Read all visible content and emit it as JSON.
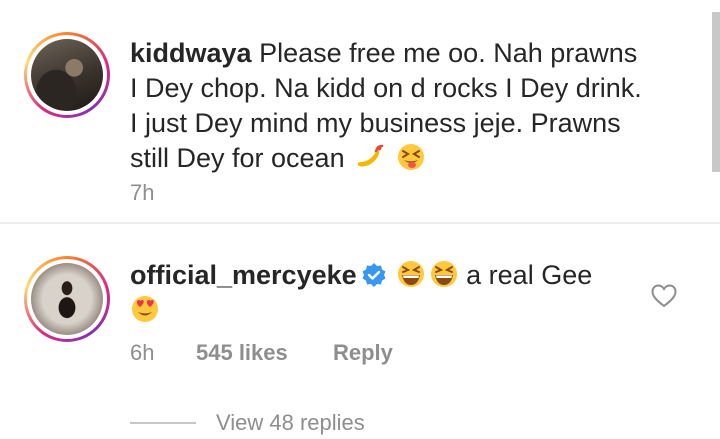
{
  "comments": [
    {
      "username": "kiddwaya",
      "text": "Please free me oo. Nah prawns I Dey chop. Na kidd on d rocks I Dey drink. I just Dey mind my business jeje.  Prawns still Dey for ocean",
      "emojis": [
        "hot-pepper-emoji",
        "squinting-tongue-emoji"
      ],
      "time": "7h"
    },
    {
      "username": "official_mercyeke",
      "verified": true,
      "text": "a real Gee",
      "emojis_before": [
        "grinning-squinting-emoji",
        "grinning-squinting-emoji"
      ],
      "emojis_after": [
        "heart-eyes-emoji"
      ],
      "time": "6h",
      "likes": "545 likes",
      "reply_label": "Reply",
      "view_replies": "View 48 replies"
    }
  ],
  "colors": {
    "text": "#262626",
    "secondary": "#8e8e8e",
    "verified": "#3897f0"
  }
}
